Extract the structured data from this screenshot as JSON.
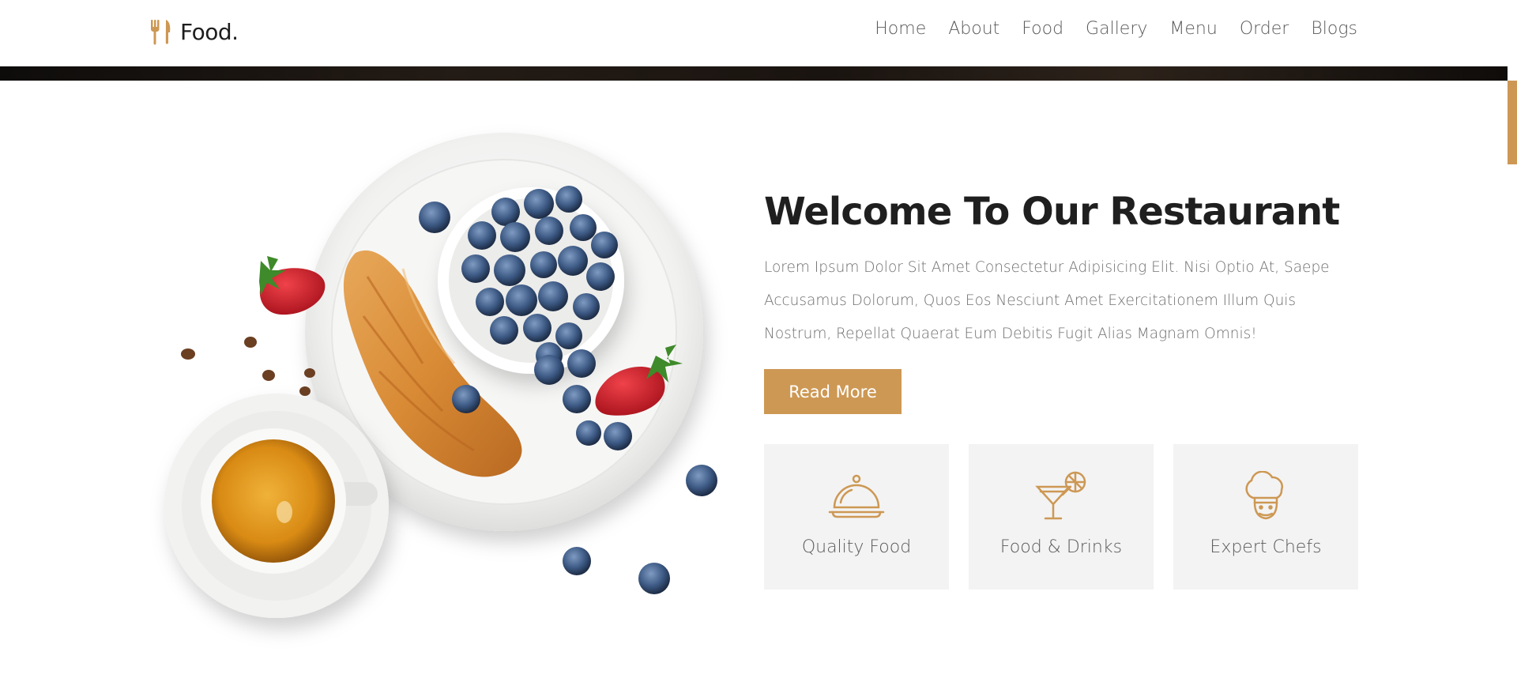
{
  "header": {
    "logo_text": "Food.",
    "nav": [
      "Home",
      "About",
      "Food",
      "Gallery",
      "Menu",
      "Order",
      "Blogs"
    ]
  },
  "hero": {
    "title": "Welcome To Our Restaurant",
    "text": "Lorem Ipsum Dolor Sit Amet Consectetur Adipisicing Elit. Nisi Optio At, Saepe Accusamus Dolorum, Quos Eos Nesciunt Amet Exercitationem Illum Quis Nostrum, Repellat Quaerat Eum Debitis Fugit Alias Magnam Omnis!",
    "button_label": "Read More"
  },
  "features": [
    {
      "label": "Quality Food",
      "icon": "cloche-icon"
    },
    {
      "label": "Food & Drinks",
      "icon": "cocktail-icon"
    },
    {
      "label": "Expert Chefs",
      "icon": "chef-hat-icon"
    }
  ],
  "colors": {
    "accent": "#cd9854",
    "card_bg": "#f3f3f3",
    "title": "#1f1f1f",
    "text": "#6f6f6f"
  }
}
